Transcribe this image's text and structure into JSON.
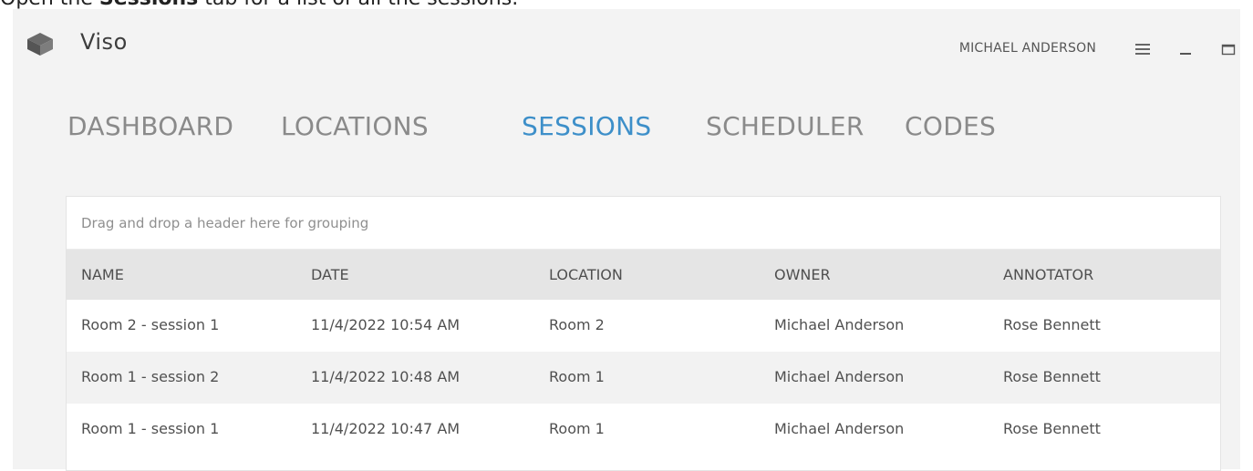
{
  "caption": {
    "prefix": "Open the ",
    "bold": "Sessions",
    "suffix": " tab for a list of all the sessions."
  },
  "app": {
    "name": "Viso",
    "user": "MICHAEL ANDERSON",
    "icons": [
      "cube-logo-icon",
      "hamburger-menu-icon",
      "minimize-icon",
      "maximize-icon"
    ]
  },
  "nav": {
    "tabs": [
      {
        "label": "DASHBOARD",
        "active": false
      },
      {
        "label": "LOCATIONS",
        "active": false
      },
      {
        "label": "SESSIONS",
        "active": true
      },
      {
        "label": "SCHEDULER",
        "active": false
      },
      {
        "label": "CODES",
        "active": false
      }
    ],
    "active_color": "#3d8fc9"
  },
  "grid": {
    "group_hint": "Drag and drop a header here for grouping",
    "columns": [
      "NAME",
      "DATE",
      "LOCATION",
      "OWNER",
      "ANNOTATOR"
    ],
    "rows": [
      [
        "Room 2 - session 1",
        "11/4/2022 10:54 AM",
        "Room 2",
        "Michael Anderson",
        "Rose Bennett"
      ],
      [
        "Room 1 - session 2",
        "11/4/2022 10:48 AM",
        "Room 1",
        "Michael Anderson",
        "Rose Bennett"
      ],
      [
        "Room 1 - session 1",
        "11/4/2022 10:47 AM",
        "Room 1",
        "Michael Anderson",
        "Rose Bennett"
      ]
    ]
  }
}
